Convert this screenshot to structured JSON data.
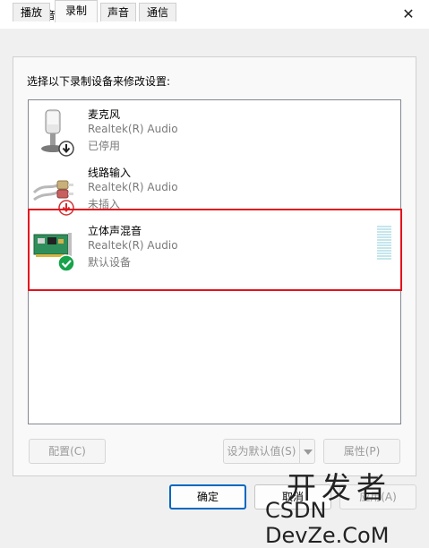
{
  "window": {
    "title": "声音",
    "close_glyph": "✕"
  },
  "tabs": [
    {
      "label": "播放",
      "active": false
    },
    {
      "label": "录制",
      "active": true
    },
    {
      "label": "声音",
      "active": false
    },
    {
      "label": "通信",
      "active": false
    }
  ],
  "prompt": "选择以下录制设备来修改设置:",
  "devices": [
    {
      "name": "麦克风",
      "driver": "Realtek(R) Audio",
      "status": "已停用",
      "icon": "microphone-icon",
      "badge": "down-arrow-badge"
    },
    {
      "name": "线路输入",
      "driver": "Realtek(R) Audio",
      "status": "未插入",
      "icon": "line-in-cable-icon",
      "badge": "red-down-arrow-badge"
    },
    {
      "name": "立体声混音",
      "driver": "Realtek(R) Audio",
      "status": "默认设备",
      "icon": "sound-card-icon",
      "badge": "green-check-badge",
      "selected_highlight": true
    }
  ],
  "buttons": {
    "configure": "配置(C)",
    "set_default": "设为默认值(S)",
    "properties": "属性(P)",
    "ok": "确定",
    "cancel": "取消",
    "apply": "应用(A)"
  },
  "watermark": {
    "line1": "开发者",
    "line2": "CSDN  DevZe.CoM"
  },
  "colors": {
    "highlight": "#e3141e",
    "default_button_border": "#0067c0",
    "level_meter": "#c5e6ed"
  }
}
